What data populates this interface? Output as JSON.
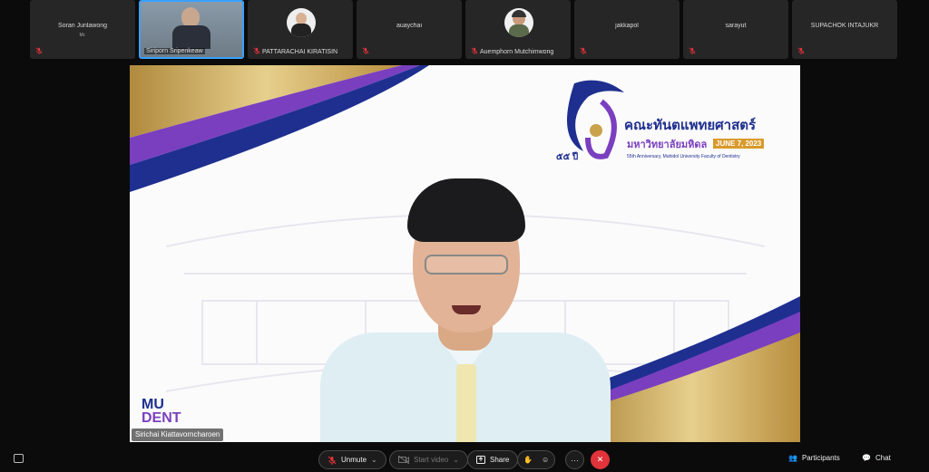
{
  "participants": [
    {
      "name": "Soran Junlawong",
      "sub": "Mr."
    },
    {
      "name": "Siriporn Sripenkeaw"
    },
    {
      "name": "PATTARACHAI KIRATISIN"
    },
    {
      "name": "auaychai"
    },
    {
      "name": "Auemphorn Mutchimwong"
    },
    {
      "name": "jakkapol"
    },
    {
      "name": "sarayut"
    },
    {
      "name": "SUPACHOK INTAJUKR"
    }
  ],
  "stage": {
    "speaker_name": "Sirichai Kiattavorncharoen",
    "logo_title": "คณะทันตแพทยศาสตร์",
    "logo_sub": "มหาวิทยาลัยมหิดล",
    "date_badge": "JUNE 7, 2023",
    "anniv_text": "55th Anniversary, Mahidol University Faculty of Dentistry",
    "num_thai": "๕๕ ปี",
    "mudent_top": "MU",
    "mudent_bottom": "DENT"
  },
  "toolbar": {
    "unmute": "Unmute",
    "start_video": "Start video",
    "share": "Share",
    "more": "···",
    "participants": "Participants",
    "chat": "Chat"
  },
  "colors": {
    "accent": "#3aa0ff",
    "end": "#e0333a",
    "purple": "#6a3fb5",
    "gold": "#c9a24a",
    "navy": "#1e2f8f"
  }
}
